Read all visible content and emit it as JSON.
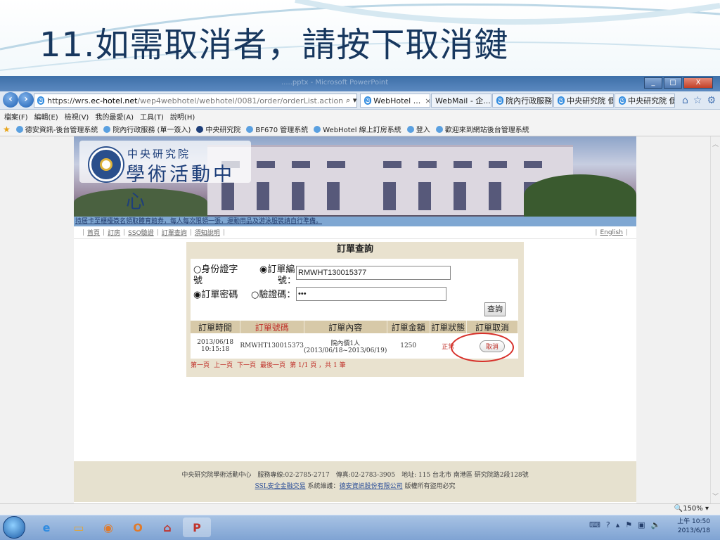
{
  "slide": {
    "title": "11.如需取消者，請按下取消鍵"
  },
  "window": {
    "title": ".....pptx - Microsoft PowerPoint",
    "btn_min": "_",
    "btn_max": "□",
    "btn_close": "X"
  },
  "address": {
    "url_prefix": "https://wrs.",
    "url_domain": "ec-hotel.net",
    "url_path": "/wep4webhotel/webhotel/0081/order/orderList.action",
    "tools": "⌕ ▾ 🔒 ↻"
  },
  "tabs": [
    {
      "label": "WebHotel ...",
      "close": "×"
    },
    {
      "label": "WebMail - 企..."
    },
    {
      "label": "院內行政服務 ..."
    },
    {
      "label": "中央研究院 個..."
    },
    {
      "label": "中央研究院 個..."
    }
  ],
  "menu": [
    "檔案(F)",
    "編輯(E)",
    "檢視(V)",
    "我的最愛(A)",
    "工具(T)",
    "說明(H)"
  ],
  "favorites": [
    "德安資訊-後台管理系統",
    "院內行政服務 (單一簽入)",
    "中央研究院",
    "BF670 管理系統",
    "WebHotel 線上訂房系統",
    "登入",
    "歡迎來到網站後台管理系統"
  ],
  "site": {
    "logo_small": "中央研究院",
    "logo_big": "學術活動中心",
    "notice": "持居卡至櫃檯簽名領取體育館券，每人每次限領一張，運動用品及游泳服裝請自行準備。",
    "nav": [
      "首頁",
      "訂房",
      "SSO驗證",
      "訂單查詢",
      "須知說明"
    ],
    "nav_english": "English"
  },
  "panel": {
    "title": "訂單查詢",
    "radio_id": "○身份證字",
    "radio_id_cont": "號",
    "radio_order": "◉訂單編",
    "order_label2": "號：",
    "order_value": "RMWHT130015377",
    "radio_pwd": "◉訂單密碼",
    "radio_code": "○驗證碼：",
    "pwd_value": "•••",
    "query_button": "查詢"
  },
  "table": {
    "headers": [
      "訂單時間",
      "訂單號碼",
      "訂單內容",
      "訂單金額",
      "訂單狀態",
      "訂單取消"
    ],
    "row": {
      "date": "2013/06/18",
      "time": "10:15:18",
      "order_no": "RMWHT130015373",
      "content1": "院內價1人",
      "content2": "(2013/06/18~2013/06/19)",
      "amount": "1250",
      "status": "正常",
      "cancel": "取消"
    }
  },
  "pager": [
    "第一頁",
    "上一頁",
    "下一頁",
    "最後一頁",
    "第 1/1 頁 ，共 1 筆"
  ],
  "footer": {
    "line1": "中央研究院學術活動中心　服務專線:02-2785-2717　傳真:02-2783-3905　地址: 115 台北市 南港區 研究院路2段128號",
    "link1": "SSL安全金融交易",
    "mid": " 系統維護：",
    "link2": "德安資訊股份有限公司",
    "tail": " 版權所有盜用必究"
  },
  "status": {
    "zoom": "150%"
  },
  "taskbar": {
    "time": "上午 10:50",
    "date": "2013/6/18"
  },
  "colors": {
    "slide_title": "#17375e",
    "accent_red": "#d7302a",
    "panel_bg": "#e9e2cf"
  }
}
